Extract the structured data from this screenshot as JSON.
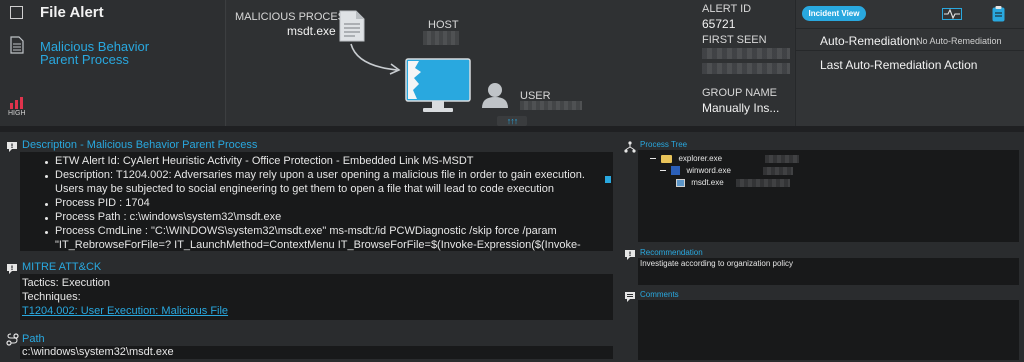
{
  "header": {
    "checkbox_checked": false,
    "title": "File Alert",
    "rule_name": "Malicious Behavior Parent Process",
    "severity": "HIGH",
    "severity_color": "#e0334c"
  },
  "process_graph": {
    "malicious_process_label": "MALICIOUS PROCESS",
    "malicious_process_value": "msdt.exe",
    "host_label": "HOST",
    "user_label": "USER",
    "expand_glyph": "↑↑↑"
  },
  "alert_info": {
    "alert_id_label": "ALERT ID",
    "alert_id_value": "65721",
    "first_seen_label": "FIRST SEEN",
    "group_name_label": "GROUP NAME",
    "group_name_value": "Manually Ins..."
  },
  "right_panel": {
    "incident_view_label": "Incident View",
    "auto_remediation_label": "Auto-Remediation:",
    "auto_remediation_value": "No Auto-Remediation",
    "last_auto_remediation_label": "Last Auto-Remediation Action"
  },
  "description": {
    "title": "Description - Malicious Behavior Parent Process",
    "lines": [
      "ETW Alert Id: CyAlert Heuristic Activity - Office Protection - Embedded Link MS-MSDT",
      "Description: T1204.002: Adversaries may rely upon a user opening a malicious file in order to gain execution.",
      "Users may be subjected to social engineering to get them to open a file that will lead to code execution",
      "Process PID : 1704",
      "Process Path : c:\\windows\\system32\\msdt.exe",
      "Process CmdLine : \"C:\\WINDOWS\\system32\\msdt.exe\" ms-msdt:/id PCWDiagnostic /skip force /param",
      "\"IT_RebrowseForFile=? IT_LaunchMethod=ContextMenu IT_BrowseForFile=$(Invoke-Expression($(Invoke-"
    ]
  },
  "mitre": {
    "title": "MITRE ATT&CK",
    "tactics": "Tactics: Execution",
    "techniques_label": "Techniques:",
    "technique_link": "T1204.002: User Execution: Malicious File"
  },
  "path": {
    "title": "Path",
    "value": "c:\\windows\\system32\\msdt.exe"
  },
  "process_tree": {
    "title": "Process Tree",
    "nodes": [
      "explorer.exe",
      "winword.exe",
      "msdt.exe"
    ]
  },
  "recommendation": {
    "title": "Recommendation",
    "text": "Investigate according to organization policy"
  },
  "comments": {
    "title": "Comments"
  },
  "colors": {
    "accent": "#29a8df",
    "background": "#2a2c2e",
    "panel_dark": "#18191a"
  }
}
